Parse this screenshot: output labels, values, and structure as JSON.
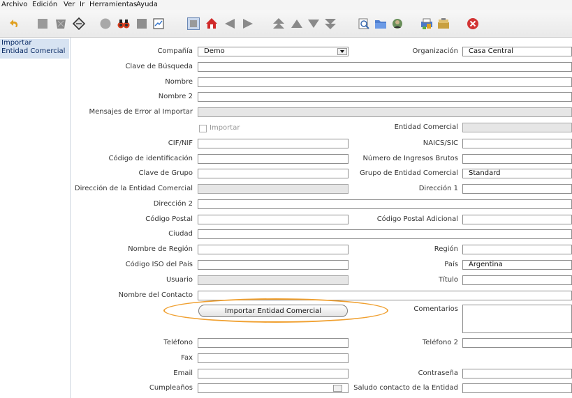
{
  "menu": {
    "items": [
      "Archivo",
      "Edición",
      "Ver",
      "Ir",
      "Herramientas",
      "Ayuda"
    ]
  },
  "toolbar": {
    "icons": [
      "undo-icon",
      "new-icon",
      "delete-icon",
      "save-icon",
      "refresh-icon",
      "find-icon",
      "history-icon",
      "report-icon",
      "grid-toggle-icon",
      "home-icon",
      "previous-icon",
      "next-icon",
      "first-icon",
      "up-icon",
      "down-icon",
      "last-icon",
      "zoom-icon",
      "attachment-icon",
      "product-icon",
      "print-icon",
      "archive-icon",
      "close-icon"
    ]
  },
  "sidebar": {
    "tab_line1": "Importar",
    "tab_line2": "Entidad Comercial"
  },
  "form": {
    "compania": {
      "label": "Compañía",
      "value": "Demo"
    },
    "organizacion": {
      "label": "Organización",
      "value": "Casa Central"
    },
    "clave_busqueda": {
      "label": "Clave de Búsqueda",
      "value": ""
    },
    "nombre": {
      "label": "Nombre",
      "value": ""
    },
    "nombre2": {
      "label": "Nombre 2",
      "value": ""
    },
    "mensajes_error": {
      "label": "Mensajes de Error al Importar",
      "value": ""
    },
    "importar_chk": {
      "label": "Importar"
    },
    "entidad_comercial": {
      "label": "Entidad Comercial",
      "value": ""
    },
    "cif_nif": {
      "label": "CIF/NIF",
      "value": ""
    },
    "naics": {
      "label": "NAICS/SIC",
      "value": ""
    },
    "codigo_identificacion": {
      "label": "Código de identificación",
      "value": ""
    },
    "ingresos_brutos": {
      "label": "Número de Ingresos Brutos",
      "value": ""
    },
    "clave_grupo": {
      "label": "Clave de Grupo",
      "value": ""
    },
    "grupo_entidad": {
      "label": "Grupo de Entidad Comercial",
      "value": "Standard"
    },
    "direccion_entidad": {
      "label": "Dirección de la Entidad Comercial",
      "value": ""
    },
    "direccion1": {
      "label": "Dirección 1",
      "value": ""
    },
    "direccion2": {
      "label": "Dirección 2",
      "value": ""
    },
    "codigo_postal": {
      "label": "Código Postal",
      "value": ""
    },
    "codigo_postal_adicional": {
      "label": "Código Postal Adicional",
      "value": ""
    },
    "ciudad": {
      "label": "Ciudad",
      "value": ""
    },
    "nombre_region": {
      "label": "Nombre de Región",
      "value": ""
    },
    "region": {
      "label": "Región",
      "value": ""
    },
    "codigo_iso": {
      "label": "Código ISO del País",
      "value": ""
    },
    "pais": {
      "label": "País",
      "value": "Argentina"
    },
    "usuario": {
      "label": "Usuario",
      "value": ""
    },
    "titulo": {
      "label": "Título",
      "value": ""
    },
    "nombre_contacto": {
      "label": "Nombre del Contacto",
      "value": ""
    },
    "import_button": {
      "label": "Importar Entidad Comercial"
    },
    "comentarios": {
      "label": "Comentarios",
      "value": ""
    },
    "telefono": {
      "label": "Teléfono",
      "value": ""
    },
    "telefono2": {
      "label": "Teléfono 2",
      "value": ""
    },
    "fax": {
      "label": "Fax",
      "value": ""
    },
    "email": {
      "label": "Email",
      "value": ""
    },
    "contrasena": {
      "label": "Contraseña",
      "value": ""
    },
    "cumpleanos": {
      "label": "Cumpleaños",
      "value": ""
    },
    "saludo_contacto": {
      "label": "Saludo contacto de la Entidad",
      "value": ""
    }
  },
  "colors": {
    "highlight": "#f0a030",
    "sidebar_tab": "#d7e3f2",
    "readonly_field": "#e6e6e6"
  }
}
